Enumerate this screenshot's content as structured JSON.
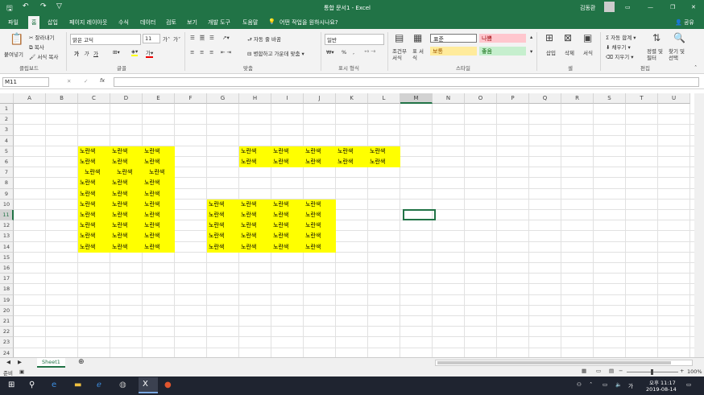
{
  "window": {
    "title": "통합 문서1  -  Excel",
    "user": "김동환",
    "share": "공유"
  },
  "tabs": [
    "파일",
    "홈",
    "삽입",
    "페이지 레이아웃",
    "수식",
    "데이터",
    "검토",
    "보기",
    "개발 도구",
    "도움말"
  ],
  "tell_me": "어떤 작업을 원하시나요?",
  "ribbon": {
    "clipboard": {
      "paste": "붙여넣기",
      "cut": "잘라내기",
      "copy": "복사",
      "format_painter": "서식 복사",
      "group": "클립보드"
    },
    "font": {
      "name": "맑은 고딕",
      "size": "11",
      "bold": "가",
      "italic": "가",
      "underline": "가",
      "group": "글꼴"
    },
    "alignment": {
      "wrap": "자동 줄 바꿈",
      "merge": "병합하고 가운데 맞춤",
      "group": "맞춤"
    },
    "number": {
      "format": "일반",
      "percent": "%",
      "group": "표시 형식"
    },
    "styles": {
      "cond": "조건부 서식",
      "table": "표 서식",
      "normal": "표준",
      "bad": "나쁨",
      "neutral": "보통",
      "good": "좋음",
      "group": "스타일"
    },
    "cells": {
      "insert": "삽입",
      "delete": "삭제",
      "format": "서식",
      "group": "셀"
    },
    "editing": {
      "autosum": "자동 합계",
      "fill": "채우기",
      "clear": "지우기",
      "sort": "정렬 및 필터",
      "find": "찾기 및 선택",
      "group": "편집"
    }
  },
  "formula_bar": {
    "name_box": "M11",
    "fx": "fx",
    "value": ""
  },
  "columns": [
    "A",
    "B",
    "C",
    "D",
    "E",
    "F",
    "G",
    "H",
    "I",
    "J",
    "K",
    "L",
    "M",
    "N",
    "O",
    "P",
    "Q",
    "R",
    "S",
    "T",
    "U"
  ],
  "rows": [
    "1",
    "2",
    "3",
    "4",
    "5",
    "6",
    "7",
    "8",
    "9",
    "10",
    "11",
    "12",
    "13",
    "14",
    "15",
    "16",
    "17",
    "18",
    "19",
    "20",
    "21",
    "22",
    "23",
    "24"
  ],
  "cell_text": "노란색",
  "sheet": {
    "tab": "Sheet1"
  },
  "status": {
    "ready": "준비",
    "zoom": "100%"
  },
  "taskbar": {
    "time": "오후 11:17",
    "date": "2019-08-14",
    "ime": "가"
  },
  "colors": {
    "excel_green": "#217346",
    "highlight": "#ffff00",
    "bad": "#ffc7ce",
    "neutral": "#ffeb9c",
    "good": "#c6efce"
  }
}
